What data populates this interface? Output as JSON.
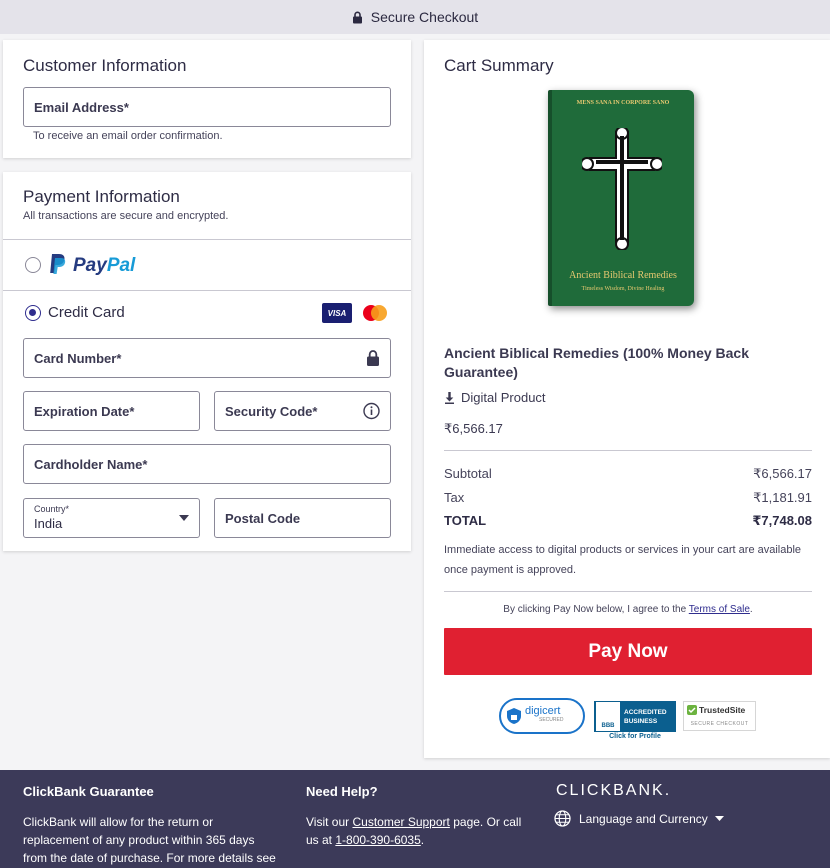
{
  "header": {
    "title": "Secure Checkout",
    "icon": "lock-icon"
  },
  "customer": {
    "title": "Customer Information",
    "email_label": "Email Address*",
    "email_help": "To receive an email order confirmation."
  },
  "payment": {
    "title": "Payment Information",
    "subtitle": "All transactions are secure and encrypted.",
    "paypal_text_1": "Pay",
    "paypal_text_2": "Pal",
    "credit_card_label": "Credit Card",
    "visa_label": "VISA",
    "card_number_label": "Card Number*",
    "expiration_label": "Expiration Date*",
    "security_code_label": "Security Code*",
    "cardholder_label": "Cardholder Name*",
    "country_label": "Country*",
    "country_value": "India",
    "postal_label": "Postal Code",
    "selected_method": "Credit Card"
  },
  "cart": {
    "title": "Cart Summary",
    "book_top_text": "MENS SANA IN CORPORE SANO",
    "book_title_text": "Ancient Biblical Remedies",
    "book_tag_text": "Timeless Wisdom, Divine Healing",
    "product_name": "Ancient Biblical Remedies (100% Money Back Guarantee)",
    "product_type": "Digital Product",
    "product_price": "₹6,566.17",
    "subtotal_label": "Subtotal",
    "subtotal_value": "₹6,566.17",
    "tax_label": "Tax",
    "tax_value": "₹1,181.91",
    "total_label": "TOTAL",
    "total_value": "₹7,748.08",
    "access_note": "Immediate access to digital products or services in your cart are available once payment is approved.",
    "agree_prefix": "By clicking Pay Now below, I agree to the",
    "terms_link": "Terms of Sale",
    "agree_suffix": ".",
    "pay_button": "Pay Now",
    "badges": {
      "digicert": "digicert",
      "digicert_sub": "SECURED",
      "bbb_1": "ACCREDITED",
      "bbb_2": "BUSINESS",
      "bbb_logo": "BBB",
      "bbb_link": "Click for Profile",
      "trusted": "TrustedSite",
      "trusted_sub": "SECURE CHECKOUT"
    }
  },
  "footer": {
    "guarantee_title": "ClickBank Guarantee",
    "guarantee_text": "ClickBank will allow for the return or replacement of any product within 365 days from the date of purchase. For more details see",
    "help_title": "Need Help?",
    "help_prefix": "Visit our",
    "help_link": "Customer Support",
    "help_mid": "page. Or call us at",
    "help_phone": "1-800-390-6035",
    "help_suffix": ".",
    "brand": "CLICKBANK.",
    "lang_label": "Language and Currency"
  },
  "colors": {
    "accent": "#2f2d8e",
    "pay": "#e02031",
    "footer": "#3c3a59",
    "book": "#1f6b3a"
  }
}
